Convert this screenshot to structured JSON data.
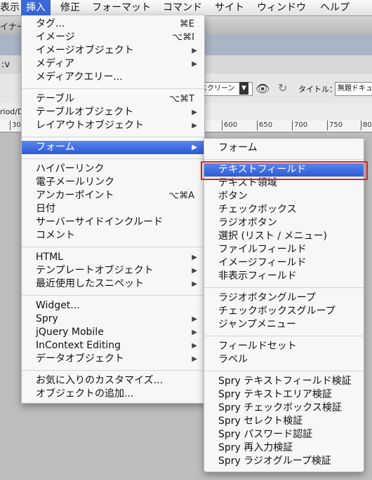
{
  "menubar": {
    "items": [
      {
        "label": "表示"
      },
      {
        "label": "挿入"
      },
      {
        "label": "修正"
      },
      {
        "label": "フォーマット"
      },
      {
        "label": "コマンド"
      },
      {
        "label": "サイト"
      },
      {
        "label": "ウィンドウ"
      },
      {
        "label": "ヘルプ"
      }
    ]
  },
  "background": {
    "designer_label": "イナー",
    "path_label": "riod/D",
    "code_label": ":v",
    "screen_select": "スクリーン",
    "title_label": "タイトル：",
    "title_value": "無題ドキュ",
    "ruler_ticks": [
      "30",
      "600",
      "650",
      "700",
      "750",
      "80"
    ]
  },
  "insert_menu": {
    "items": [
      {
        "label": "タグ...",
        "shortcut": "⌘E"
      },
      {
        "label": "イメージ",
        "shortcut": "⌥⌘I"
      },
      {
        "label": "イメージオブジェクト"
      },
      {
        "label": "メディア"
      },
      {
        "label": "メディアクエリー..."
      },
      {
        "label": "テーブル",
        "shortcut": "⌥⌘T"
      },
      {
        "label": "テーブルオブジェクト"
      },
      {
        "label": "レイアウトオブジェクト"
      },
      {
        "label": "フォーム"
      },
      {
        "label": "ハイパーリンク"
      },
      {
        "label": "電子メールリンク"
      },
      {
        "label": "アンカーポイント",
        "shortcut": "⌥⌘A"
      },
      {
        "label": "日付"
      },
      {
        "label": "サーバーサイドインクルード"
      },
      {
        "label": "コメント"
      },
      {
        "label": "HTML"
      },
      {
        "label": "テンプレートオブジェクト"
      },
      {
        "label": "最近使用したスニペット"
      },
      {
        "label": "Widget..."
      },
      {
        "label": "Spry"
      },
      {
        "label": "jQuery Mobile"
      },
      {
        "label": "InContext Editing"
      },
      {
        "label": "データオブジェクト"
      },
      {
        "label": "お気に入りのカスタマイズ..."
      },
      {
        "label": "オブジェクトの追加..."
      }
    ]
  },
  "form_submenu": {
    "items": [
      {
        "label": "フォーム"
      },
      {
        "label": "テキストフィールド"
      },
      {
        "label": "テキスト領域"
      },
      {
        "label": "ボタン"
      },
      {
        "label": "チェックボックス"
      },
      {
        "label": "ラジオボタン"
      },
      {
        "label": "選択 (リスト / メニュー)"
      },
      {
        "label": "ファイルフィールド"
      },
      {
        "label": "イメージフィールド"
      },
      {
        "label": "非表示フィールド"
      },
      {
        "label": "ラジオボタングループ"
      },
      {
        "label": "チェックボックスグループ"
      },
      {
        "label": "ジャンプメニュー"
      },
      {
        "label": "フィールドセット"
      },
      {
        "label": "ラベル"
      },
      {
        "label": "Spry テキストフィールド検証"
      },
      {
        "label": "Spry テキストエリア検証"
      },
      {
        "label": "Spry チェックボックス検証"
      },
      {
        "label": "Spry セレクト検証"
      },
      {
        "label": "Spry パスワード認証"
      },
      {
        "label": "Spry 再入力検証"
      },
      {
        "label": "Spry ラジオグループ検証"
      }
    ]
  },
  "icons": {
    "submenu_arrow": "triangle-right-icon",
    "refresh": "refresh-icon",
    "eye": "visual-aids-icon"
  },
  "colors": {
    "highlight": "#2f60d8",
    "focus_outline": "#d8232a"
  }
}
